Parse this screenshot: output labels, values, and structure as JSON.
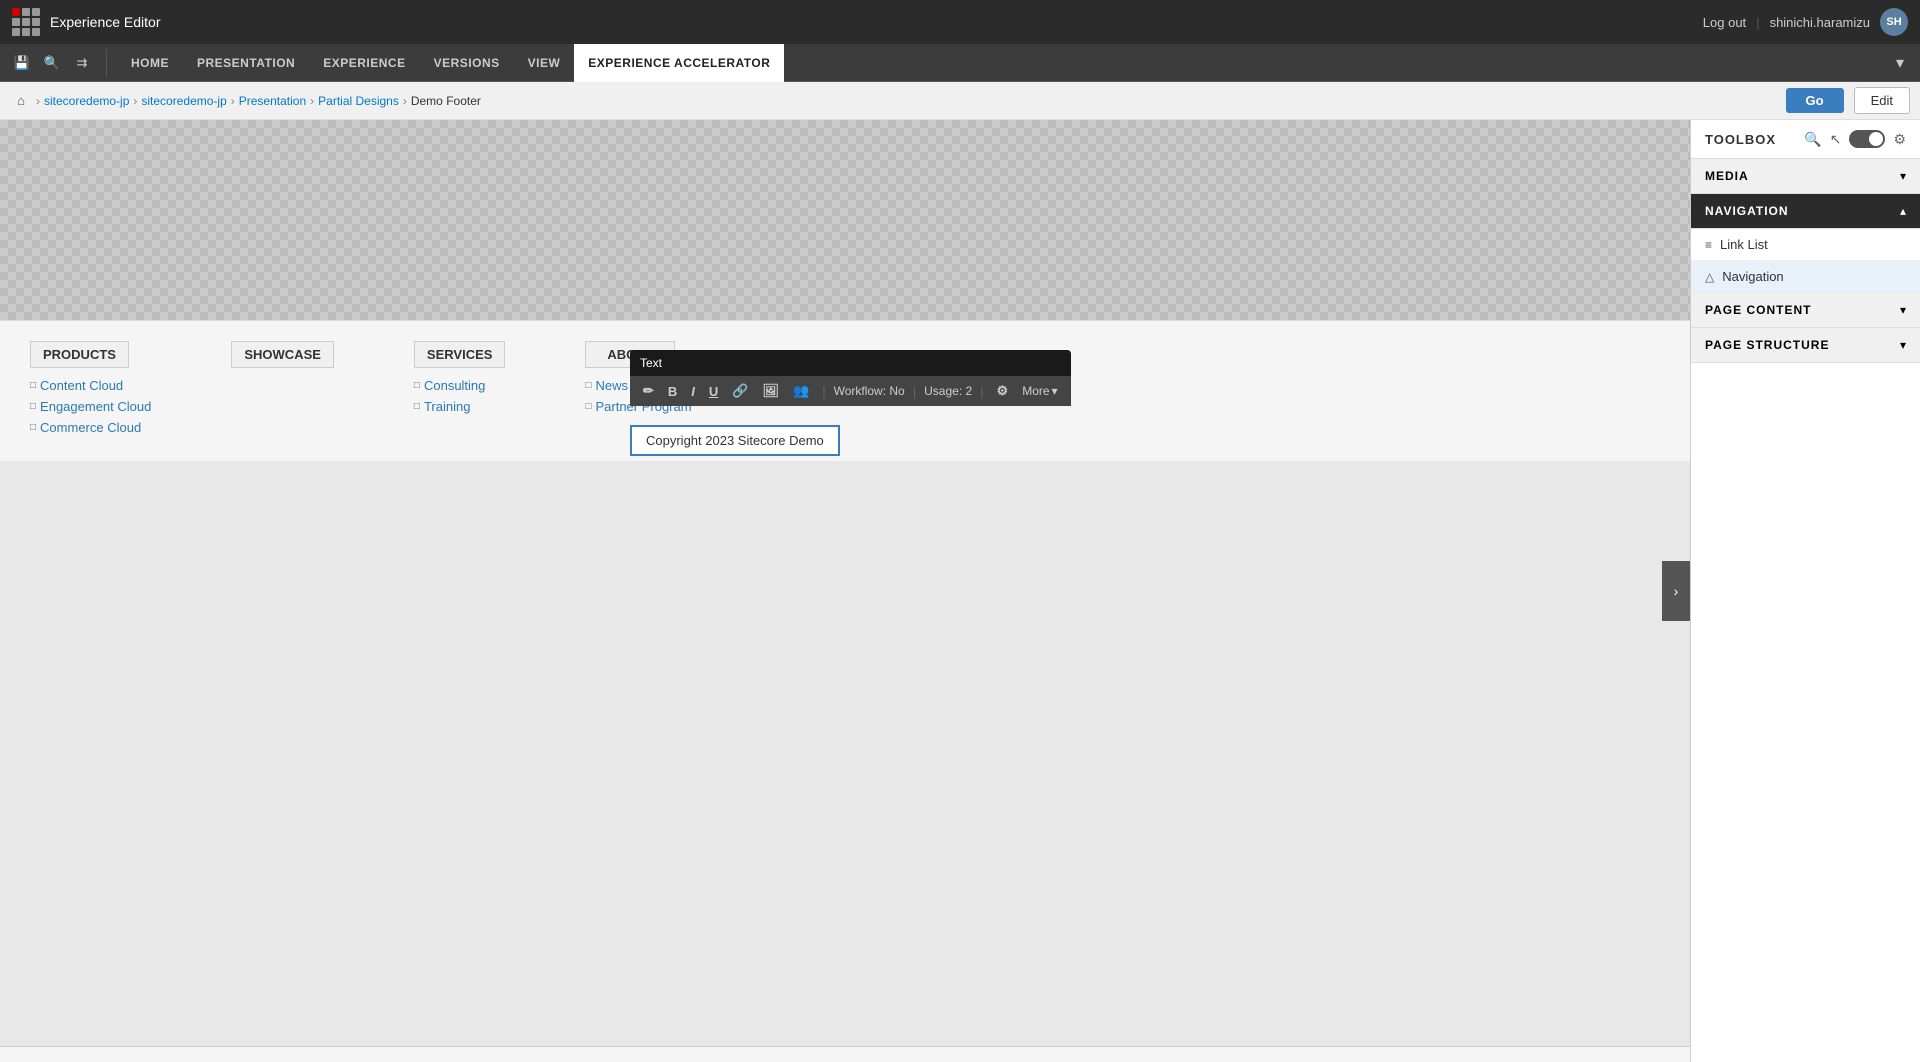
{
  "app": {
    "title": "Experience Editor"
  },
  "topbar": {
    "logout_label": "Log out",
    "separator": "|",
    "username": "shinichi.haramizu",
    "avatar_initials": "SH"
  },
  "nav_tabs": {
    "tabs": [
      {
        "id": "home",
        "label": "HOME",
        "active": false
      },
      {
        "id": "presentation",
        "label": "PRESENTATION",
        "active": false
      },
      {
        "id": "experience",
        "label": "EXPERIENCE",
        "active": false
      },
      {
        "id": "versions",
        "label": "VERSIONS",
        "active": false
      },
      {
        "id": "view",
        "label": "VIEW",
        "active": false
      },
      {
        "id": "experience-accelerator",
        "label": "EXPERIENCE ACCELERATOR",
        "active": true
      }
    ]
  },
  "breadcrumb": {
    "home_title": "Home",
    "items": [
      {
        "id": "sitecoredemo1",
        "label": "sitecoredemo-jp",
        "active": false
      },
      {
        "id": "sitecoredemo2",
        "label": "sitecoredemo-jp",
        "active": false
      },
      {
        "id": "presentation",
        "label": "Presentation",
        "active": false
      },
      {
        "id": "partial-designs",
        "label": "Partial Designs",
        "active": false
      },
      {
        "id": "demo-footer",
        "label": "Demo Footer",
        "active": true
      }
    ],
    "go_label": "Go",
    "edit_label": "Edit"
  },
  "footer": {
    "columns": [
      {
        "id": "products",
        "header": "PRODUCTS",
        "links": [
          "Content Cloud",
          "Engagement Cloud",
          "Commerce Cloud"
        ]
      },
      {
        "id": "showcase",
        "header": "SHOWCASE",
        "links": []
      },
      {
        "id": "services",
        "header": "SERVICES",
        "links": [
          "Consulting",
          "Training"
        ]
      },
      {
        "id": "about",
        "header": "ABOUT",
        "links": [
          "News Release",
          "Partner Program"
        ]
      }
    ],
    "copyright": "Copyright 2023 Sitecore Demo"
  },
  "floating_toolbar": {
    "title": "Text",
    "buttons": [
      "✏",
      "B",
      "I",
      "U",
      "🔗",
      "🖼",
      "👥"
    ],
    "workflow_label": "Workflow: No",
    "usage_label": "Usage: 2",
    "more_label": "More"
  },
  "toolbox": {
    "title": "TOOLBOX",
    "sections": [
      {
        "id": "media",
        "label": "MEDIA",
        "expanded": false,
        "items": []
      },
      {
        "id": "navigation",
        "label": "NAVIGATION",
        "expanded": true,
        "items": [
          {
            "id": "link-list",
            "label": "Link List",
            "icon": "≡"
          },
          {
            "id": "navigation",
            "label": "Navigation",
            "icon": "△"
          }
        ]
      },
      {
        "id": "page-content",
        "label": "PAGE CONTENT",
        "expanded": false,
        "items": []
      },
      {
        "id": "page-structure",
        "label": "PAGE STRUCTURE",
        "expanded": false,
        "items": []
      }
    ]
  }
}
